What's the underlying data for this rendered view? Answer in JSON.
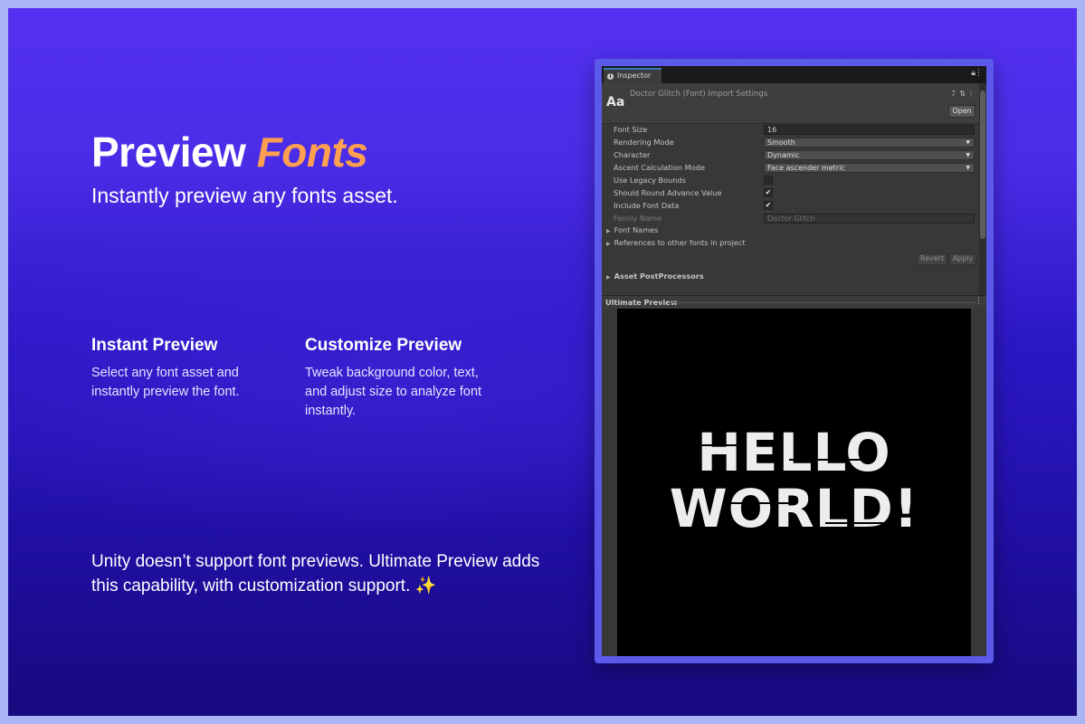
{
  "hero": {
    "title_main": "Preview",
    "title_accent": "Fonts",
    "subtitle": "Instantly preview any fonts asset."
  },
  "features": [
    {
      "title": "Instant Preview",
      "description": "Select any font asset and instantly preview the font."
    },
    {
      "title": "Customize Preview",
      "description": "Tweak background color, text, and adjust size to analyze font instantly."
    }
  ],
  "footer": {
    "text": "Unity doesn’t support font previews. Ultimate Preview adds this capability, with customization support.",
    "emoji": "✨"
  },
  "inspector": {
    "tab_label": "Inspector",
    "asset_icon_text": "Aa",
    "asset_title": "Doctor Glitch (Font) Import Settings",
    "open_button": "Open",
    "fields": {
      "font_size": {
        "label": "Font Size",
        "value": "16"
      },
      "rendering_mode": {
        "label": "Rendering Mode",
        "value": "Smooth"
      },
      "character": {
        "label": "Character",
        "value": "Dynamic"
      },
      "ascent_mode": {
        "label": "Ascent Calculation Mode",
        "value": "Face ascender metric"
      },
      "legacy_bounds": {
        "label": "Use Legacy Bounds",
        "checked": false
      },
      "round_advance": {
        "label": "Should Round Advance Value",
        "checked": true
      },
      "include_font_data": {
        "label": "Include Font Data",
        "checked": true
      },
      "family_name": {
        "label": "Family Name",
        "value": "Doctor Glitch"
      }
    },
    "foldouts": {
      "font_names": "Font Names",
      "references": "References to other fonts in project",
      "post_processors": "Asset PostProcessors"
    },
    "revert_button": "Revert",
    "apply_button": "Apply",
    "preview_title": "Ultimate Preview",
    "preview_text_line1": "HELLO",
    "preview_text_line2": "WORLD!",
    "colors": {
      "panel_bg": "#383838",
      "preview_bg": "#000000",
      "preview_text": "#ededed",
      "accent": "#ff9f50"
    }
  }
}
